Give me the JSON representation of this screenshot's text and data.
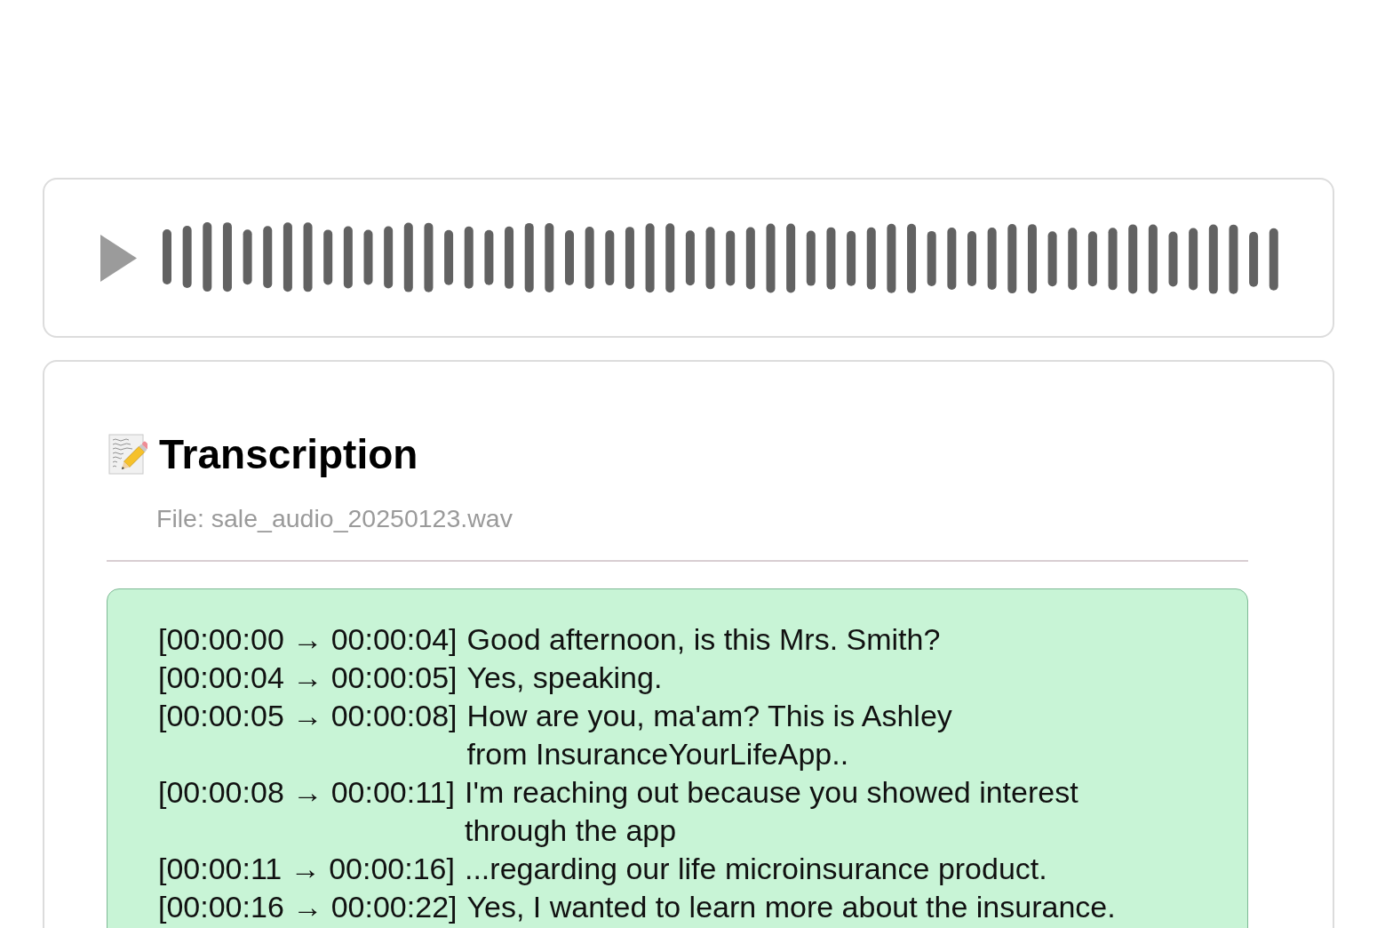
{
  "player": {
    "playing": false
  },
  "transcription": {
    "title": "Transcription",
    "file": "File: sale_audio_20250123.wav",
    "segments": [
      {
        "time": "[00:00:00 → 00:00:04]",
        "lines": [
          "Good afternoon, is this Mrs. Smith?"
        ]
      },
      {
        "time": "[00:00:04 → 00:00:05]",
        "lines": [
          "Yes, speaking."
        ]
      },
      {
        "time": "[00:00:05 → 00:00:08]",
        "lines": [
          "How are you, ma'am? This is Ashley",
          "from InsuranceYourLifeApp.."
        ]
      },
      {
        "time": "[00:00:08 → 00:00:11]",
        "lines": [
          "I'm reaching out because you showed interest",
          "through the app"
        ]
      },
      {
        "time": "[00:00:11 → 00:00:16]",
        "lines": [
          "...regarding our life microinsurance product."
        ]
      },
      {
        "time": "[00:00:16 → 00:00:22]",
        "lines": [
          "Yes, I wanted to learn more about the insurance."
        ]
      }
    ]
  }
}
